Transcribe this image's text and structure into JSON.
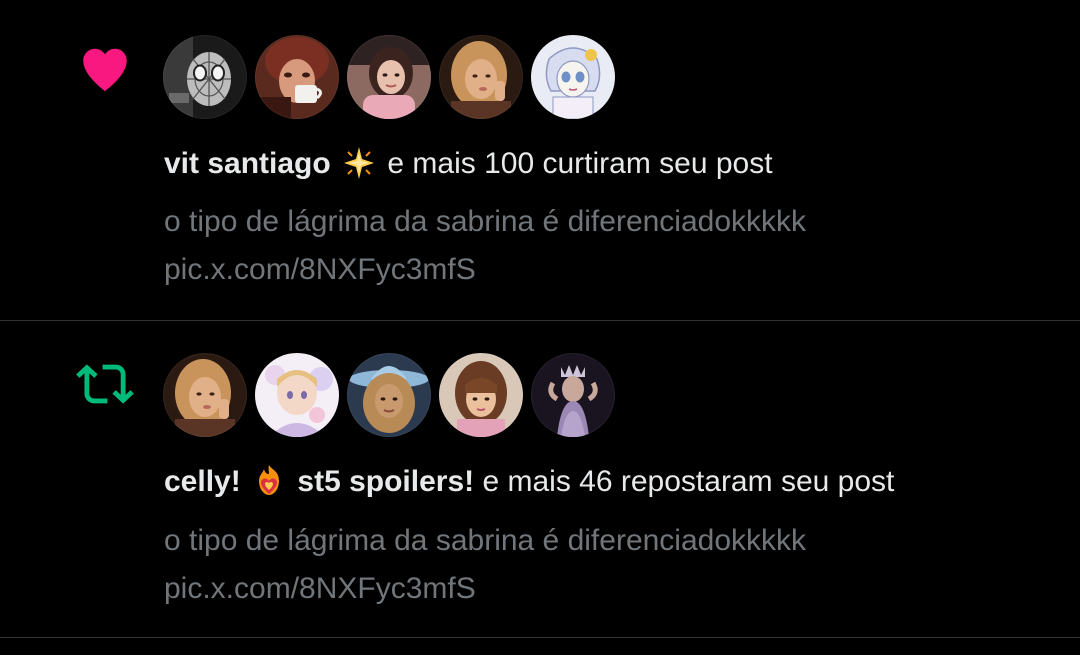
{
  "notifications": [
    {
      "type": "like",
      "type_icon": "heart-icon",
      "type_icon_color": "#f91880",
      "avatars": [
        {
          "icon": "avatar-spiderman",
          "colors": [
            "#d8d8d8",
            "#303030"
          ]
        },
        {
          "icon": "avatar-person-cup",
          "colors": [
            "#c9906f",
            "#3a1c14"
          ]
        },
        {
          "icon": "avatar-person-selfie",
          "colors": [
            "#e7b7a8",
            "#5a3a36"
          ]
        },
        {
          "icon": "avatar-person-blonde",
          "colors": [
            "#d8a774",
            "#3b2418"
          ]
        },
        {
          "icon": "avatar-doll-drawing",
          "colors": [
            "#eef0f8",
            "#9aa5c9"
          ]
        }
      ],
      "actor": "vit santiago",
      "actor_emoji": "glowing-star-icon",
      "action": "e mais 100 curtiram seu post",
      "post_text": "o tipo de lágrima da sabrina é diferenciadokkkkk",
      "post_link": "pic.x.com/8NXFyc3mfS"
    },
    {
      "type": "repost",
      "type_icon": "repost-icon",
      "type_icon_color": "#00ba7c",
      "avatars": [
        {
          "icon": "avatar-person-blonde",
          "colors": [
            "#d8a774",
            "#3b2418"
          ]
        },
        {
          "icon": "avatar-anime-drawing",
          "colors": [
            "#f2e8f2",
            "#c9b5d8"
          ]
        },
        {
          "icon": "avatar-person-cowboy-hat",
          "colors": [
            "#c49565",
            "#2f3c4c"
          ]
        },
        {
          "icon": "avatar-person-bangs",
          "colors": [
            "#e4b791",
            "#4a2a1c"
          ]
        },
        {
          "icon": "avatar-person-crown",
          "colors": [
            "#8f7a9a",
            "#1e1522"
          ]
        }
      ],
      "actor": "celly!",
      "actor_emoji": "heart-on-fire-icon",
      "actor_suffix": "st5 spoilers!",
      "action": "e mais 46 repostaram seu post",
      "post_text": "o tipo de lágrima da sabrina é diferenciadokkkkk",
      "post_link": "pic.x.com/8NXFyc3mfS"
    }
  ]
}
